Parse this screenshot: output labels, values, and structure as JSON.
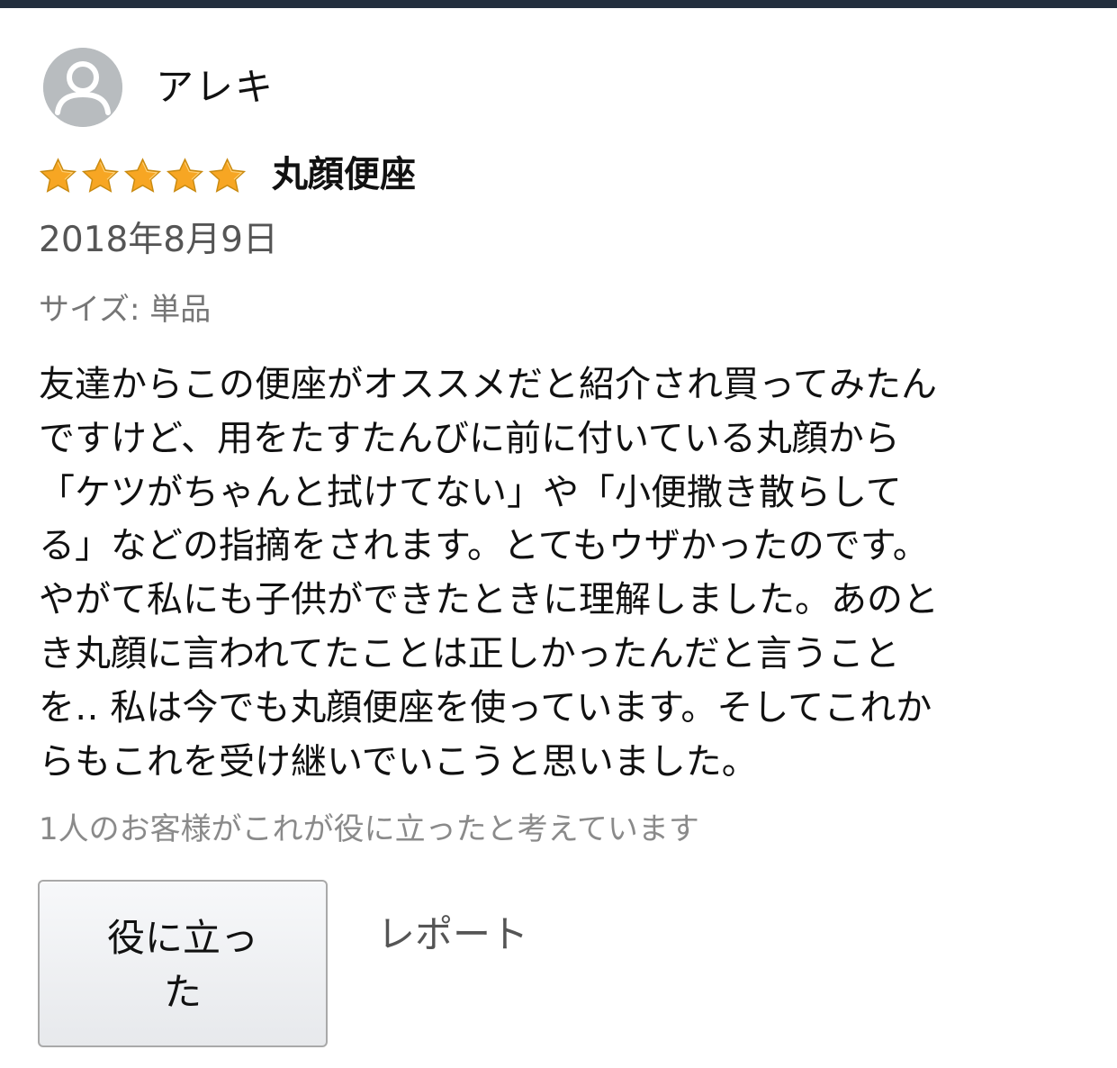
{
  "reviewer": {
    "name": "アレキ",
    "avatar_icon": "default-user-avatar-icon"
  },
  "rating": {
    "stars": 5,
    "max": 5,
    "star_color": "#f7a623"
  },
  "review": {
    "title": "丸顔便座",
    "date": "2018年8月9日",
    "variant": "サイズ: 単品",
    "body_lines": [
      "友達からこの便座がオススメだと紹介され買ってみたん",
      "ですけど、用をたすたんびに前に付いている丸顔から",
      "「ケツがちゃんと拭けてない」や「小便撒き散らして",
      "る」などの指摘をされます。とてもウザかったのです。",
      "やがて私にも子供ができたときに理解しました。あのと",
      "き丸顔に言われてたことは正しかったんだと言うこと",
      "を‥ 私は今でも丸顔便座を使っています。そしてこれか",
      "らもこれを受け継いでいこうと思いました。"
    ],
    "helpful_count_text": "1人のお客様がこれが役に立ったと考えています"
  },
  "actions": {
    "helpful_button_lines": [
      "役に立っ",
      "た"
    ],
    "report_label": "レポート"
  },
  "colors": {
    "top_bar": "#232f3e",
    "avatar_bg": "#b8bcbf",
    "star": "#f7a623"
  }
}
